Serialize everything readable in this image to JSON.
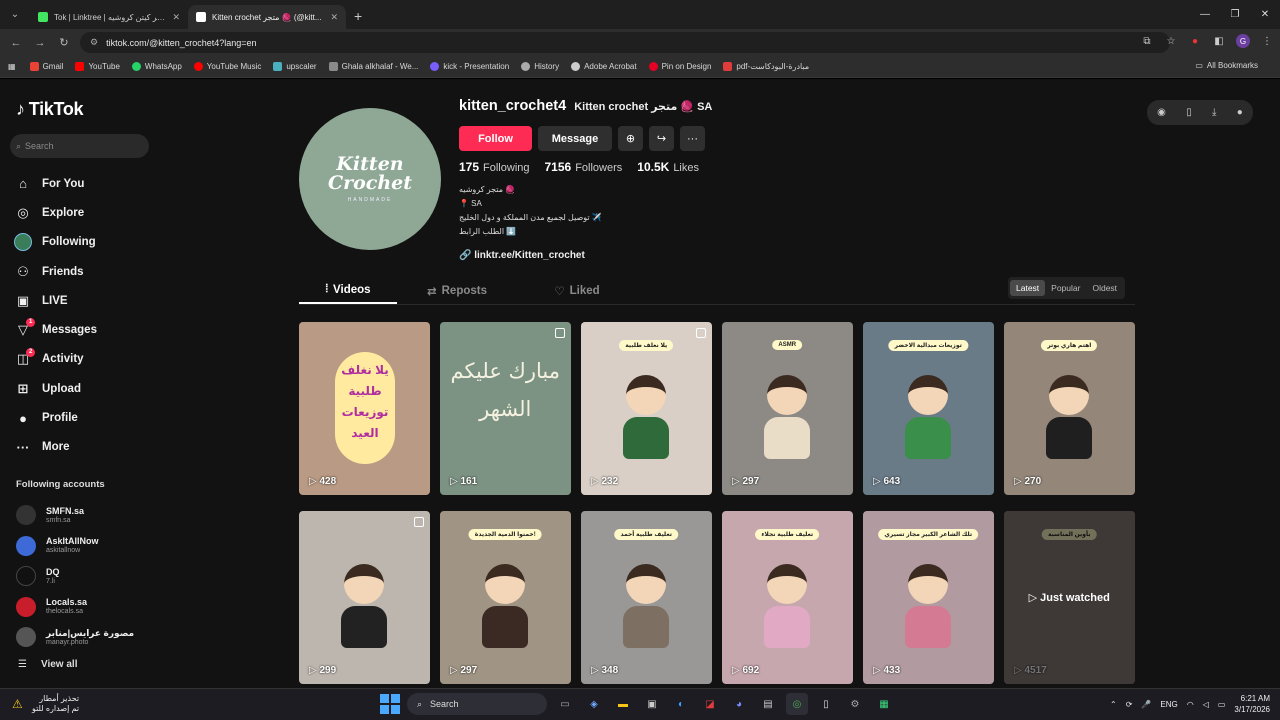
{
  "browser": {
    "tabs": [
      {
        "title": "Tok | Linktree | متجر كيتن كروشيه",
        "fav_color": "#43e660",
        "active": false
      },
      {
        "title": "Kitten crochet متجر 🧶 (@kitt...",
        "fav_color": "#ffffff",
        "active": true
      }
    ],
    "url": "tiktok.com/@kitten_crochet4?lang=en",
    "bookmarks": [
      {
        "label": "Gmail",
        "color": "#ea4335"
      },
      {
        "label": "YouTube",
        "color": "#ff0000"
      },
      {
        "label": "WhatsApp",
        "color": "#25d366"
      },
      {
        "label": "YouTube Music",
        "color": "#ff0000"
      },
      {
        "label": "upscaler",
        "color": "#4ab0c0"
      },
      {
        "label": "Ghala alkhalaf - We...",
        "color": "#8a8a8a"
      },
      {
        "label": "kick - Presentation",
        "color": "#7b5cff"
      },
      {
        "label": "History",
        "color": "#aaaaaa"
      },
      {
        "label": "Adobe Acrobat",
        "color": "#cccccc"
      },
      {
        "label": "Pin on Design",
        "color": "#e60023"
      },
      {
        "label": "pdf-مبادرة-البودكاست",
        "color": "#e03c3c"
      }
    ],
    "all_bookmarks": "All Bookmarks"
  },
  "sidebar": {
    "logo": "TikTok",
    "search_placeholder": "Search",
    "items": [
      {
        "label": "For You",
        "icon": "home-icon",
        "glyph": "⌂"
      },
      {
        "label": "Explore",
        "icon": "compass-icon",
        "glyph": "◎"
      },
      {
        "label": "Following",
        "icon": "avatar-icon",
        "glyph": ""
      },
      {
        "label": "Friends",
        "icon": "friends-icon",
        "glyph": "👥"
      },
      {
        "label": "LIVE",
        "icon": "live-icon",
        "glyph": "▣"
      },
      {
        "label": "Messages",
        "icon": "messages-icon",
        "glyph": "▽",
        "badge": "1"
      },
      {
        "label": "Activity",
        "icon": "activity-icon",
        "glyph": "◫",
        "badge": "2"
      },
      {
        "label": "Upload",
        "icon": "upload-icon",
        "glyph": "⊕"
      },
      {
        "label": "Profile",
        "icon": "profile-icon",
        "glyph": "●"
      },
      {
        "label": "More",
        "icon": "more-icon",
        "glyph": "···"
      }
    ],
    "following_title": "Following accounts",
    "following": [
      {
        "name": "SMFN.sa",
        "handle": "smfn.sa",
        "color": "#333"
      },
      {
        "name": "AskItAllNow",
        "handle": "askitallnow",
        "color": "#3d6ad6"
      },
      {
        "name": "DQ",
        "handle": "7.li",
        "color": "#111"
      },
      {
        "name": "Locals.sa",
        "handle": "thelocals.sa",
        "color": "#c81e2b"
      },
      {
        "name": "مصورة عرايس|منابر",
        "handle": "manayr.photo",
        "color": "#555"
      }
    ],
    "view_all": "View all"
  },
  "profile": {
    "avatar_line1": "Kitten",
    "avatar_line2": "Crochet",
    "avatar_sub": "HANDMADE",
    "username": "kitten_crochet4",
    "nickname": "Kitten crochet متجر 🧶 SA",
    "follow": "Follow",
    "message": "Message",
    "following_count": "175",
    "following_label": "Following",
    "followers_count": "7156",
    "followers_label": "Followers",
    "likes_count": "10.5K",
    "likes_label": "Likes",
    "bio": [
      "متجر كروشيه 🧶",
      "📍 SA",
      "توصيل لجميع مدن المملكة و دول الخليج ✈️",
      "الطلب الرابط ⬇️"
    ],
    "link": "linktr.ee/Kitten_crochet"
  },
  "tabs": {
    "videos": "Videos",
    "reposts": "Reposts",
    "liked": "Liked"
  },
  "sort": {
    "latest": "Latest",
    "popular": "Popular",
    "oldest": "Oldest"
  },
  "videos": [
    {
      "views": "428",
      "bg": "#b99a84",
      "oval": "يلا نغلف طلبية توزيعات العيد"
    },
    {
      "views": "161",
      "bg": "#7c9282",
      "arabic": "مبارك عليكم الشهر",
      "multi": true
    },
    {
      "views": "232",
      "bg": "#d9cfc6",
      "label": "يلا نغلف طلبية",
      "doll": "#2f6a3a",
      "multi": true
    },
    {
      "views": "297",
      "bg": "#8d8a85",
      "label": "ASMR",
      "doll": "#e9ddc8"
    },
    {
      "views": "643",
      "bg": "#6a7b88",
      "label": "توزيعات مبدالية الاخضر",
      "doll": "#3a8f4a"
    },
    {
      "views": "270",
      "bg": "#94877a",
      "label": "اهتم هاري بوتر",
      "doll": "#1f1f1f"
    },
    {
      "views": "299",
      "bg": "#bdb6ae",
      "doll": "#222",
      "multi": true
    },
    {
      "views": "297",
      "bg": "#a09484",
      "label": "خمنوا الدمية الجديدة!",
      "doll": "#3b2a24"
    },
    {
      "views": "348",
      "bg": "#9a9896",
      "label": "تغليف طلبية أحمد",
      "doll": "#7d6f62"
    },
    {
      "views": "692",
      "bg": "#c7a7ae",
      "label": "تغليف طلبية نجلاء",
      "doll": "#e2a9c4"
    },
    {
      "views": "433",
      "bg": "#b19aa0",
      "label": "تلك الشاعر الكبير مجاز تسيري",
      "doll": "#d47b93"
    },
    {
      "views": "4517",
      "bg": "#8a7e7a",
      "label": "بأوين المناسبة",
      "watched": "Just watched"
    }
  ],
  "taskbar": {
    "weather_line1": "تحذير أمطار",
    "weather_line2": "تم إصداره للتو",
    "search": "Search",
    "lang": "ENG",
    "time": "6:21 AM",
    "date": "3/17/2026"
  }
}
